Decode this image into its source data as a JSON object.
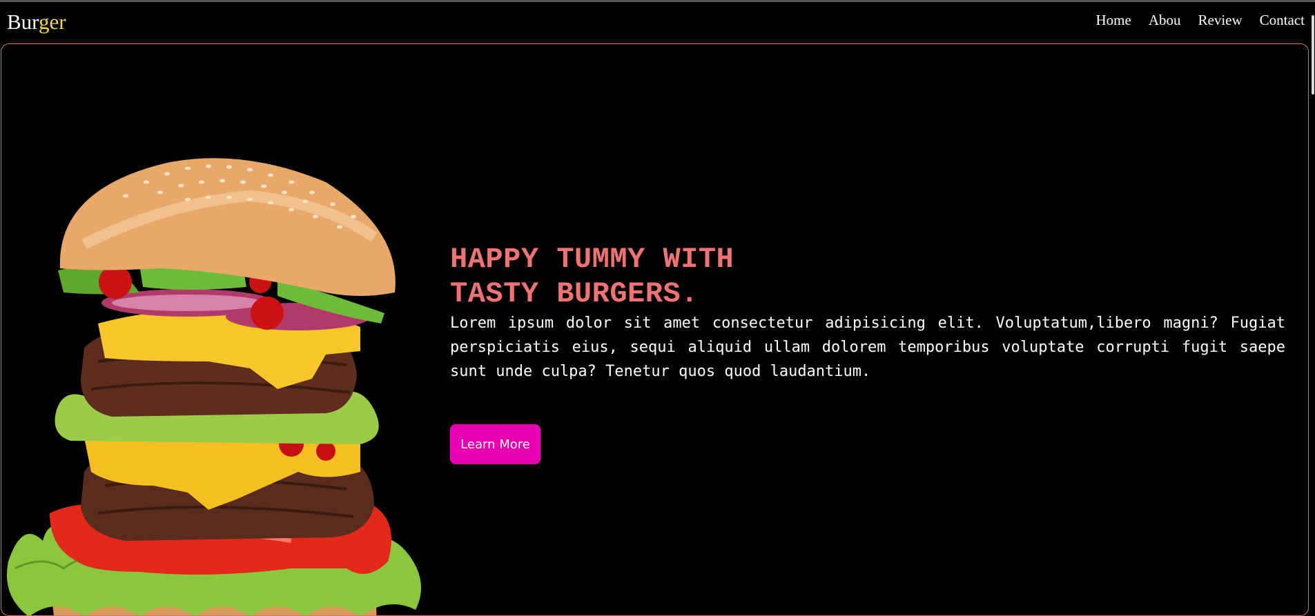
{
  "header": {
    "logo_primary": "Bur",
    "logo_accent": "ger",
    "nav": [
      {
        "label": "Home"
      },
      {
        "label": "Abou"
      },
      {
        "label": "Review"
      },
      {
        "label": "Contact"
      }
    ]
  },
  "hero": {
    "headline_line1": "HAPPY TUMMY WITH",
    "headline_line2": "TASTY BURGERS.",
    "body": "Lorem ipsum dolor sit amet consectetur adipisicing elit. Voluptatum,libero magni? Fugiat perspiciatis eius, sequi aliquid ullam dolorem temporibus voluptate corrupti fugit saepe sunt unde culpa? Tenetur quos quod laudantium.",
    "cta_label": "Learn More"
  },
  "colors": {
    "background": "#000000",
    "headline": "#f07373",
    "border": "#ef6b6b",
    "logo_accent": "#f5d742",
    "button": "#e800b0"
  },
  "icons": {
    "hero_image": "burger-image"
  }
}
